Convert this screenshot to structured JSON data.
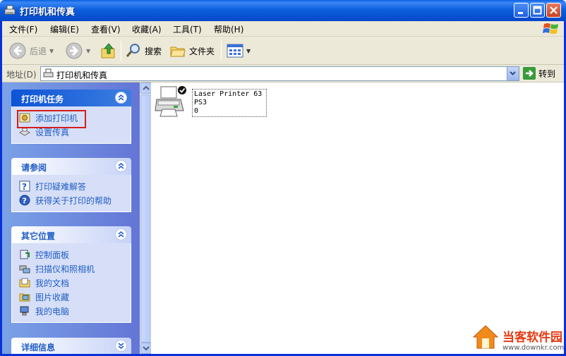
{
  "window": {
    "title": "打印机和传真",
    "icon": "printer-fax-icon",
    "controls": [
      "minimize",
      "maximize",
      "close"
    ]
  },
  "menu": {
    "items": [
      "文件(F)",
      "编辑(E)",
      "查看(V)",
      "收藏(A)",
      "工具(T)",
      "帮助(H)"
    ]
  },
  "toolbar": {
    "back_label": "后退",
    "search_label": "搜索",
    "folders_label": "文件夹"
  },
  "address": {
    "label": "地址(D)",
    "value": "打印机和传真",
    "go_label": "转到"
  },
  "taskpane": {
    "panels": [
      {
        "title": "打印机任务",
        "items": [
          {
            "label": "添加打印机",
            "icon": "add-printer-icon"
          },
          {
            "label": "设置传真",
            "icon": "fax-icon"
          }
        ]
      },
      {
        "title": "请参阅",
        "items": [
          {
            "label": "打印疑难解答",
            "icon": "help-question-icon"
          },
          {
            "label": "获得关于打印的帮助",
            "icon": "help-circle-icon"
          }
        ]
      },
      {
        "title": "其它位置",
        "items": [
          {
            "label": "控制面板",
            "icon": "control-panel-icon"
          },
          {
            "label": "扫描仪和照相机",
            "icon": "scanner-camera-icon"
          },
          {
            "label": "我的文档",
            "icon": "my-documents-icon"
          },
          {
            "label": "图片收藏",
            "icon": "my-pictures-icon"
          },
          {
            "label": "我的电脑",
            "icon": "my-computer-icon"
          }
        ]
      },
      {
        "title": "详细信息",
        "items": []
      }
    ]
  },
  "printers": [
    {
      "name_line1": "Laser Printer 63",
      "name_line2": "PS3",
      "status_line": "0",
      "default": true
    }
  ],
  "watermark": {
    "site_name": "当客软件园",
    "url": "www.downkr.com"
  },
  "colors": {
    "titlebar": "#0a5ee0",
    "taskpane": "#7ba2e7",
    "link": "#215dc6",
    "highlight": "#d41e1e"
  }
}
